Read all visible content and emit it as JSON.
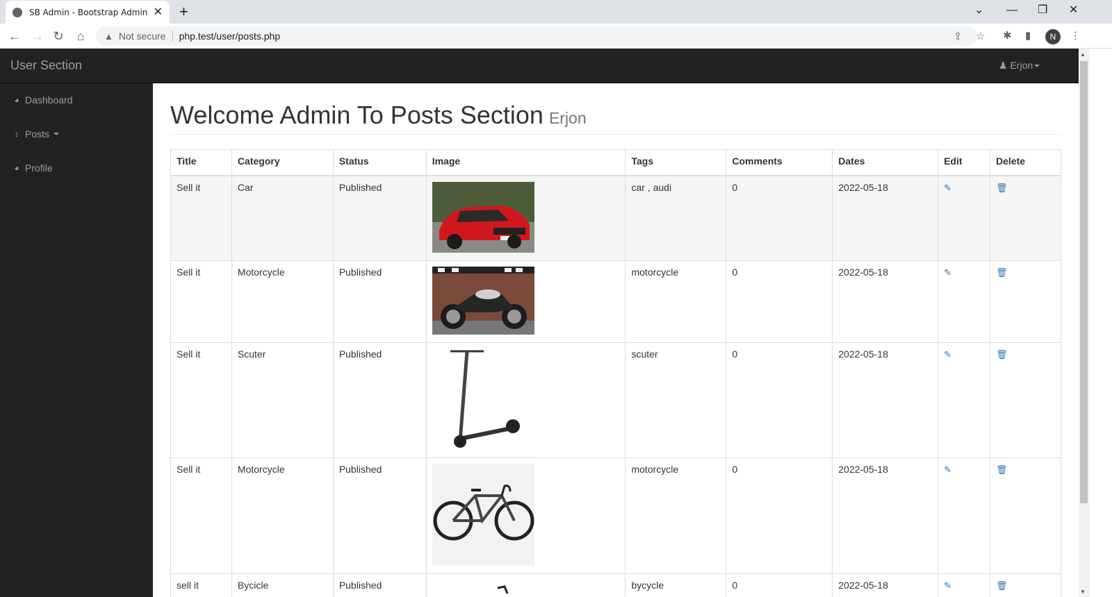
{
  "browser": {
    "tab_title": "SB Admin - Bootstrap Admin Ten",
    "security_label": "Not secure",
    "url": "php.test/user/posts.php",
    "profile_initial": "N"
  },
  "navbar": {
    "brand": "User Section",
    "user_name": "Erjon"
  },
  "sidebar": {
    "items": [
      {
        "label": "Dashboard",
        "icon": "dashboard-icon"
      },
      {
        "label": "Posts",
        "icon": "arrows-v-icon"
      },
      {
        "label": "Profile",
        "icon": "dashboard-icon"
      }
    ]
  },
  "page": {
    "heading": "Welcome Admin To Posts Section",
    "subheading": "Erjon"
  },
  "table": {
    "headers": [
      "Title",
      "Category",
      "Status",
      "Image",
      "Tags",
      "Comments",
      "Dates",
      "Edit",
      "Delete"
    ],
    "rows": [
      {
        "title": "Sell it",
        "category": "Car",
        "status": "Published",
        "image": "red-car",
        "tags": "car , audi",
        "comments": "0",
        "date": "2022-05-18"
      },
      {
        "title": "Sell it",
        "category": "Motorcycle",
        "status": "Published",
        "image": "motorcycle",
        "tags": "motorcycle",
        "comments": "0",
        "date": "2022-05-18"
      },
      {
        "title": "Sell it",
        "category": "Scuter",
        "status": "Published",
        "image": "scooter",
        "tags": "scuter",
        "comments": "0",
        "date": "2022-05-18"
      },
      {
        "title": "Sell it",
        "category": "Motorcycle",
        "status": "Published",
        "image": "bicycle",
        "tags": "motorcycle",
        "comments": "0",
        "date": "2022-05-18"
      },
      {
        "title": "sell it",
        "category": "Bycicle",
        "status": "Published",
        "image": "bicycle-partial",
        "tags": "bycycle",
        "comments": "0",
        "date": "2022-05-18"
      }
    ]
  },
  "colors": {
    "navbar_bg": "#222222",
    "link_blue": "#337ab7",
    "striped_row": "#f5f5f5"
  }
}
